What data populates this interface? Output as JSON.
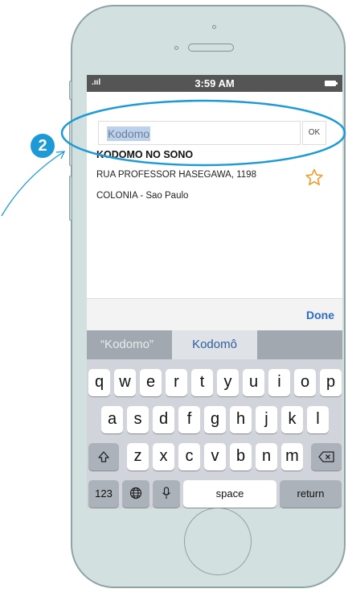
{
  "status_bar": {
    "signal": ".ııl",
    "time": "3:59 AM"
  },
  "search": {
    "value": "Kodomo",
    "ok_label": "OK"
  },
  "result": {
    "name": "KODOMO NO SONO",
    "address_line": "RUA PROFESSOR HASEGAWA, 1198",
    "district_line": "COLONIA - Sao Paulo",
    "favorite_icon": "star-outline-icon"
  },
  "accessory": {
    "done_label": "Done"
  },
  "suggestions": [
    "“Kodomo”",
    "Kodomô"
  ],
  "keyboard": {
    "row1": [
      "q",
      "w",
      "e",
      "r",
      "t",
      "y",
      "u",
      "i",
      "o",
      "p"
    ],
    "row2": [
      "a",
      "s",
      "d",
      "f",
      "g",
      "h",
      "j",
      "k",
      "l"
    ],
    "row3": [
      "z",
      "x",
      "c",
      "v",
      "b",
      "n",
      "m"
    ],
    "row4": [
      "123",
      "\u0000",
      "\u0000",
      "space",
      "return"
    ],
    "shift_icon": "shift-icon",
    "delete_icon": "delete-icon",
    "globe_icon": "globe-icon",
    "mic_icon": "mic-icon"
  },
  "annotation": {
    "step": "2"
  },
  "colors": {
    "accent": "#1d9ad6",
    "done": "#2b6cc4",
    "star": "#f0a030"
  }
}
